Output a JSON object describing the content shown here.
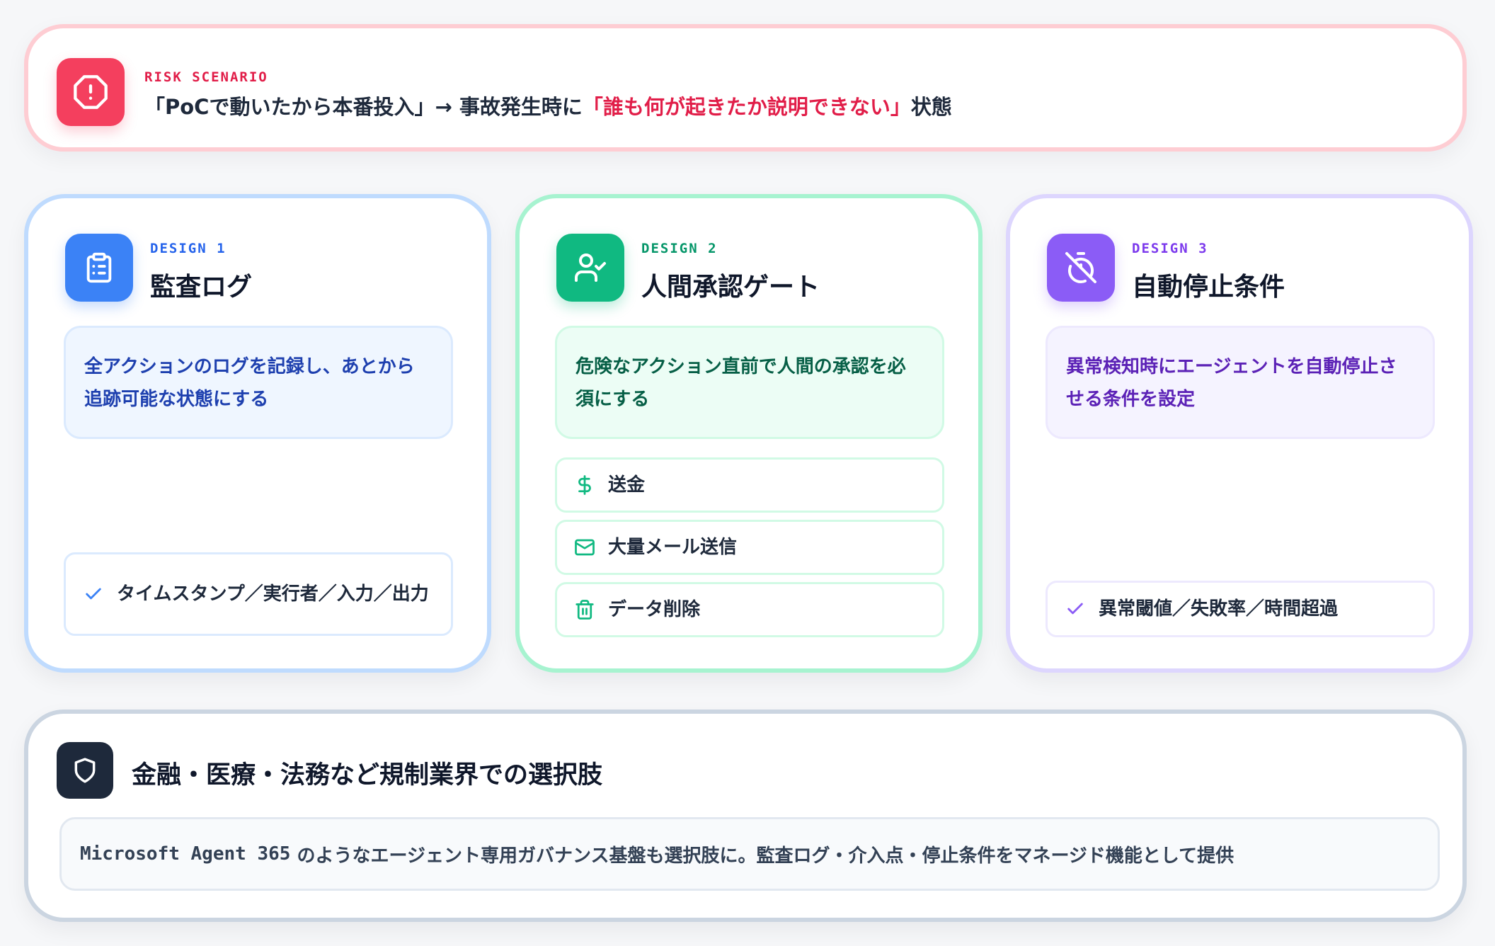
{
  "risk": {
    "tag": "RISK SCENARIO",
    "title_part1": "「PoCで動いたから本番投入」→ 事故発生時に",
    "title_highlight": "「誰も何が起きたか説明できない」",
    "title_part2": "状態",
    "icon": "alert-octagon-icon",
    "accent": "#f43f5e"
  },
  "designs": [
    {
      "tag": "DESIGN 1",
      "title": "監査ログ",
      "icon": "clipboard-list-icon",
      "accent": "#3b82f6",
      "description": "全アクションのログを記録し、あとから追跡可能な状態にする",
      "items": [
        {
          "icon": "check-icon",
          "label": "タイムスタンプ／実行者／入力／出力"
        }
      ]
    },
    {
      "tag": "DESIGN 2",
      "title": "人間承認ゲート",
      "icon": "user-check-icon",
      "accent": "#10b981",
      "description": "危険なアクション直前で人間の承認を必須にする",
      "items": [
        {
          "icon": "dollar-icon",
          "label": "送金"
        },
        {
          "icon": "mail-icon",
          "label": "大量メール送信"
        },
        {
          "icon": "trash-icon",
          "label": "データ削除"
        }
      ]
    },
    {
      "tag": "DESIGN 3",
      "title": "自動停止条件",
      "icon": "timer-off-icon",
      "accent": "#8b5cf6",
      "description": "異常検知時にエージェントを自動停止させる条件を設定",
      "items": [
        {
          "icon": "check-icon",
          "label": "異常閾値／失敗率／時間超過"
        }
      ]
    }
  ],
  "bottom": {
    "icon": "shield-icon",
    "title": "金融・医療・法務など規制業界での選択肢",
    "product": "Microsoft Agent 365",
    "text": "のようなエージェント専用ガバナンス基盤も選択肢に。監査ログ・介入点・停止条件をマネージド機能として提供"
  }
}
